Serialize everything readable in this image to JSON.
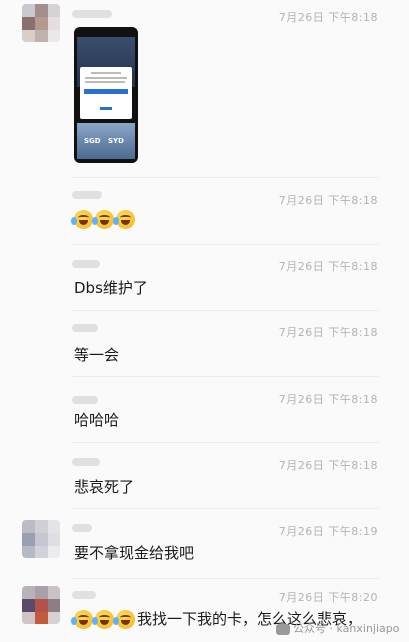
{
  "messages": [
    {
      "time": "7月26日 下午8:18",
      "kind": "image",
      "thumb": {
        "left_label": "SGD",
        "right_label": "SYD"
      }
    },
    {
      "time": "7月26日 下午8:18",
      "kind": "emoji",
      "emoji": [
        "rolling-laugh-emoji",
        "rolling-laugh-emoji",
        "rolling-laugh-emoji"
      ],
      "text": ""
    },
    {
      "time": "7月26日 下午8:18",
      "kind": "text",
      "text": "Dbs维护了"
    },
    {
      "time": "7月26日 下午8:18",
      "kind": "text",
      "text": "等一会"
    },
    {
      "time": "7月26日 下午8:18",
      "kind": "text",
      "text": "哈哈哈"
    },
    {
      "time": "7月26日 下午8:18",
      "kind": "text",
      "text": "悲哀死了"
    },
    {
      "time": "7月26日 下午8:19",
      "kind": "text",
      "text": "要不拿现金给我吧"
    },
    {
      "time": "7月26日 下午8:20",
      "kind": "emoji_text",
      "emoji": [
        "rolling-laugh-emoji",
        "rolling-laugh-emoji",
        "rolling-laugh-emoji"
      ],
      "text": "我找一下我的卡，怎么这么悲哀，"
    }
  ],
  "watermark": {
    "prefix": "公众号 ·",
    "handle": "kanxinjiapo"
  },
  "colors": {
    "background": "#fafafa",
    "time_text": "#b3b3b3",
    "divider": "#ececec"
  }
}
